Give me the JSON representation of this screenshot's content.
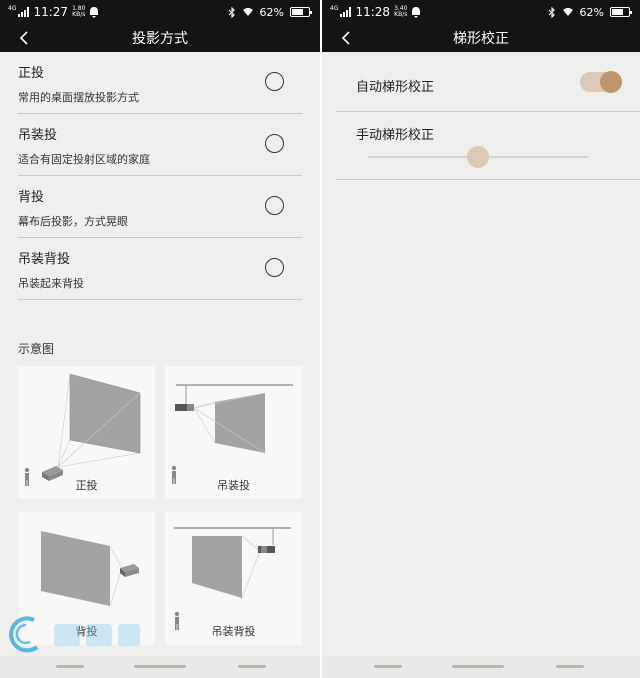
{
  "left": {
    "status": {
      "net": "4G",
      "time": "11:27",
      "speed_value": "1.80",
      "speed_unit": "KB/s",
      "battery": "62%",
      "battery_level": 0.62
    },
    "title": "投影方式",
    "options": [
      {
        "title": "正投",
        "subtitle": "常用的桌面摆放投影方式"
      },
      {
        "title": "吊装投",
        "subtitle": "适合有固定投射区域的家庭"
      },
      {
        "title": "背投",
        "subtitle": "幕布后投影，方式晃眼"
      },
      {
        "title": "吊装背投",
        "subtitle": "吊装起来背投"
      }
    ],
    "diagram_label": "示意图",
    "diagrams": [
      {
        "caption": "正投"
      },
      {
        "caption": "吊装投"
      },
      {
        "caption": "背投"
      },
      {
        "caption": "吊装背投"
      }
    ]
  },
  "right": {
    "status": {
      "net": "4G",
      "time": "11:28",
      "speed_value": "3.40",
      "speed_unit": "KB/s",
      "battery": "62%",
      "battery_level": 0.62
    },
    "title": "梯形校正",
    "auto_label": "自动梯形校正",
    "auto_enabled": true,
    "manual_label": "手动梯形校正",
    "manual_value": 0.5
  },
  "colors": {
    "bar": "#141414",
    "accent": "#bf9669",
    "accent_light": "#dcc9b4",
    "screen": "#a3a3a3"
  }
}
